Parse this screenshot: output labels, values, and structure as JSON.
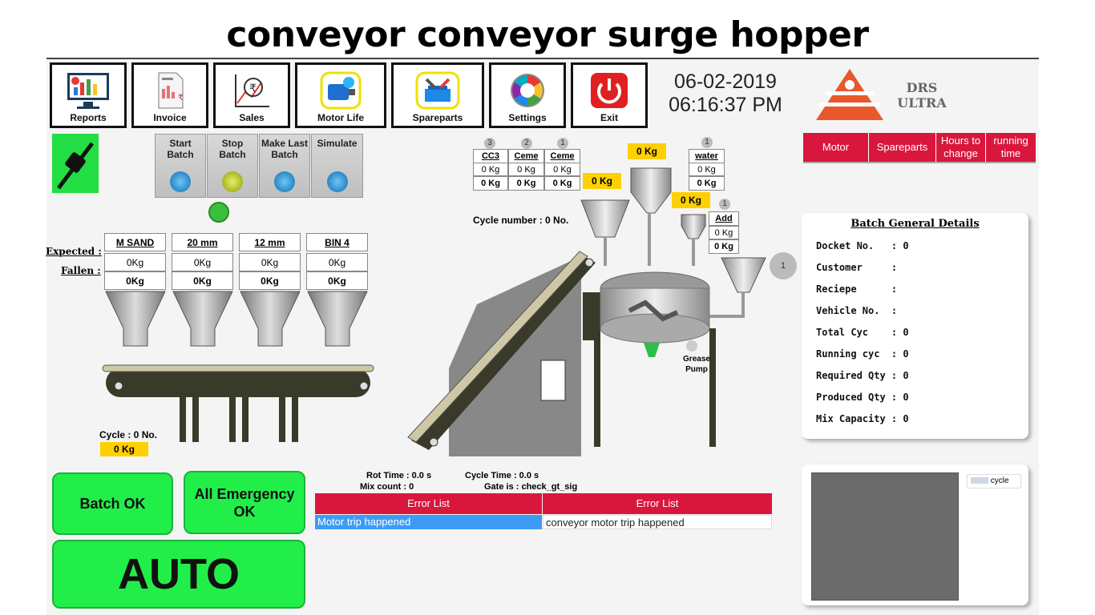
{
  "title": "conveyor conveyor surge hopper",
  "toolbar": [
    {
      "label": "Reports",
      "icon": "reports-icon"
    },
    {
      "label": "Invoice",
      "icon": "invoice-icon"
    },
    {
      "label": "Sales",
      "icon": "sales-icon"
    },
    {
      "label": "Motor Life",
      "icon": "motor-life-icon"
    },
    {
      "label": "Spareparts",
      "icon": "spareparts-icon"
    },
    {
      "label": "Settings",
      "icon": "settings-icon"
    },
    {
      "label": "Exit",
      "icon": "power-icon"
    }
  ],
  "datetime": {
    "date": "06-02-2019",
    "time": "06:16:37 PM"
  },
  "brand": {
    "line1": "DRS",
    "line2": "ULTRA"
  },
  "tabs": [
    "Motor",
    "Spareparts",
    "Hours to change",
    "running time"
  ],
  "controls": [
    "Start Batch",
    "Stop Batch",
    "Make Last Batch",
    "Simulate"
  ],
  "bins": {
    "expected_label": "Expected :",
    "fallen_label": "Fallen :",
    "items": [
      {
        "name": "M SAND",
        "expected": "0Kg",
        "fallen": "0Kg"
      },
      {
        "name": "20 mm",
        "expected": "0Kg",
        "fallen": "0Kg"
      },
      {
        "name": "12 mm",
        "expected": "0Kg",
        "fallen": "0Kg"
      },
      {
        "name": "BIN 4",
        "expected": "0Kg",
        "fallen": "0Kg"
      }
    ]
  },
  "silos": [
    {
      "num": "3",
      "name": "CC3",
      "exp": "0 Kg",
      "fal": "0 Kg"
    },
    {
      "num": "2",
      "name": "Ceme",
      "exp": "0 Kg",
      "fal": "0 Kg"
    },
    {
      "num": "1",
      "name": "Ceme",
      "exp": "0 Kg",
      "fal": "0 Kg"
    }
  ],
  "water": {
    "num": "1",
    "name": "water",
    "exp": "0 Kg",
    "fal": "0 Kg"
  },
  "add": {
    "num": "1",
    "name": "Add",
    "exp": "0 Kg",
    "fal": "0 Kg"
  },
  "weights": {
    "cement": "0 Kg",
    "water": "0 Kg",
    "silo": "0 Kg",
    "add": "0 Kg"
  },
  "cycle_number": "Cycle number : 0 No.",
  "cycle_left": {
    "label": "Cycle  : 0 No.",
    "value": "0 Kg"
  },
  "grease": "Grease Pump",
  "mixer_num": "1",
  "batch": {
    "heading": "Batch General Details",
    "rows": [
      "Docket No.   : 0",
      "Customer     :",
      "Reciepe      :",
      "Vehicle No.  :",
      "Total Cyc    : 0",
      "Running cyc  : 0",
      "Required Qty : 0",
      "Produced Qty : 0",
      "Mix Capacity : 0"
    ]
  },
  "chart_legend": "cycle",
  "status": {
    "rot_time": "Rot Time : 0.0 s",
    "mix_count": "Mix count : 0",
    "cycle_time": "Cycle Time : 0.0 s",
    "gate": "Gate is : check_gt_sig"
  },
  "errors": {
    "header_left": "Error List",
    "header_right": "Error List",
    "left": "Motor trip happened",
    "right": "conveyor motor trip happened"
  },
  "buttons": {
    "batch_ok": "Batch OK",
    "emergency_ok": "All Emergency OK",
    "auto": "AUTO"
  },
  "colors": {
    "accent_red": "#d9173d",
    "ok_green": "#22ee4a",
    "weight_yellow": "#ffd000",
    "error_blue": "#3d9bf5"
  }
}
